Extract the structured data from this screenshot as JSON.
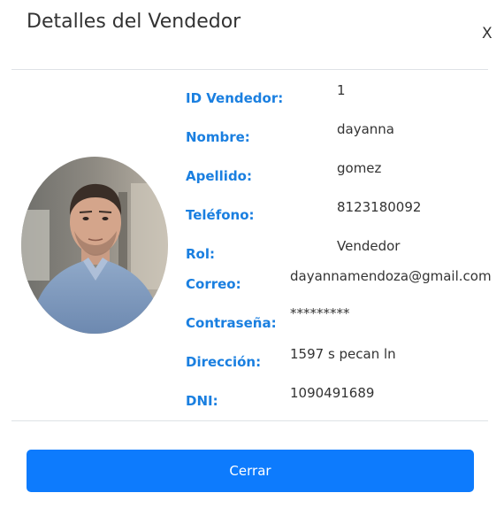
{
  "modal": {
    "title": "Detalles del Vendedor",
    "close_label": "X",
    "avatar_icon": "user-photo"
  },
  "fields": [
    {
      "label": "ID Vendedor:",
      "value": "1"
    },
    {
      "label": "Nombre:",
      "value": "dayanna"
    },
    {
      "label": "Apellido:",
      "value": "gomez"
    },
    {
      "label": "Teléfono:",
      "value": "8123180092"
    },
    {
      "label": "Rol:",
      "value": "Vendedor"
    },
    {
      "label": "Correo:",
      "value": "dayannamendoza@gmail.com"
    },
    {
      "label": "Contraseña:",
      "value": "*********"
    },
    {
      "label": "Dirección:",
      "value": "1597 s pecan ln"
    },
    {
      "label": "DNI:",
      "value": "1090491689"
    }
  ],
  "footer": {
    "close_button_label": "Cerrar"
  },
  "colors": {
    "label": "#1a7fe0",
    "primary_button": "#0d7bfd",
    "divider": "#dee2e6"
  }
}
